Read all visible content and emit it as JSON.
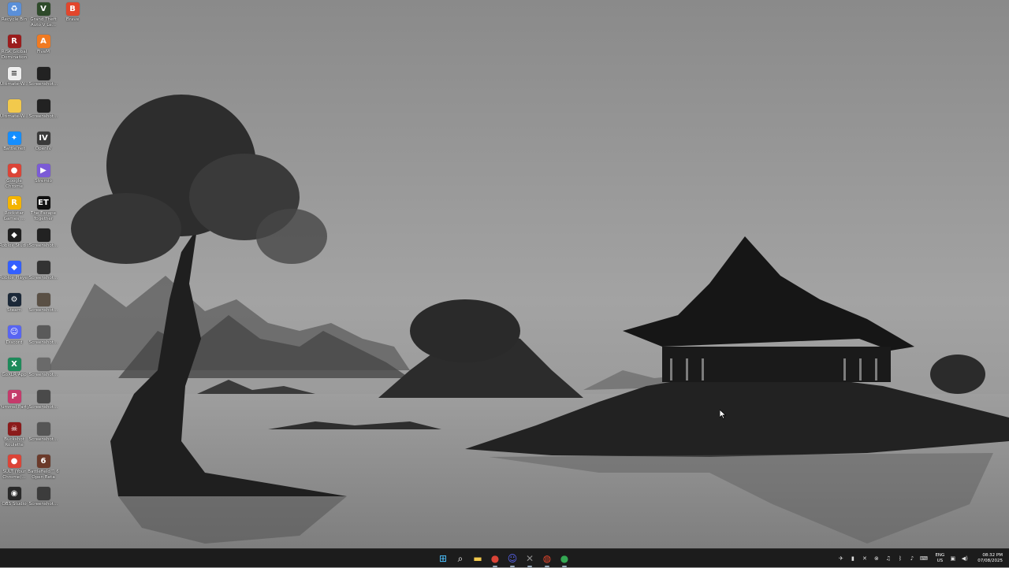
{
  "desktop": {
    "icons": [
      {
        "label": "Recycle Bin",
        "icon": "recycle-bin-icon",
        "color": "#5a8fd8",
        "glyph": "♻"
      },
      {
        "label": "Grand Theft Auto V Le...",
        "icon": "gta-icon",
        "color": "#2e4a2a",
        "glyph": "V"
      },
      {
        "label": "Brave",
        "icon": "brave-icon",
        "color": "#e2462c",
        "glyph": "B"
      },
      {
        "label": "RISK Global Domination",
        "icon": "risk-icon",
        "color": "#9b1c1c",
        "glyph": "R"
      },
      {
        "label": "FiveM",
        "icon": "fivem-icon",
        "color": "#f07a22",
        "glyph": "A"
      },
      {
        "label": "Ultimate-W...",
        "icon": "text-file-icon",
        "color": "#eeeeee",
        "glyph": "≡"
      },
      {
        "label": "Screenshot...",
        "icon": "screenshot-icon",
        "color": "#222222",
        "glyph": ""
      },
      {
        "label": "Ultimate-W...",
        "icon": "folder-icon",
        "color": "#f2c94c",
        "glyph": ""
      },
      {
        "label": "Screenshot...",
        "icon": "screenshot-icon",
        "color": "#222222",
        "glyph": ""
      },
      {
        "label": "Battle.net",
        "icon": "battlenet-icon",
        "color": "#148eff",
        "glyph": "✦"
      },
      {
        "label": "OpenIV",
        "icon": "openiv-icon",
        "color": "#3a3a3a",
        "glyph": "IV"
      },
      {
        "label": "Google Chrome",
        "icon": "chrome-icon",
        "color": "#db4437",
        "glyph": "●"
      },
      {
        "label": "Stremio",
        "icon": "stremio-icon",
        "color": "#7b5bd6",
        "glyph": "▶"
      },
      {
        "label": "Rockstar Games ...",
        "icon": "rockstar-icon",
        "color": "#f4b400",
        "glyph": "R"
      },
      {
        "label": "The Escape Together",
        "icon": "escape-together-icon",
        "color": "#111111",
        "glyph": "ET"
      },
      {
        "label": "Roblox Studio",
        "icon": "roblox-studio-icon",
        "color": "#1f1f1f",
        "glyph": "◆"
      },
      {
        "label": "Screenshot...",
        "icon": "screenshot-icon",
        "color": "#222222",
        "glyph": ""
      },
      {
        "label": "Roblox Player",
        "icon": "roblox-player-icon",
        "color": "#335fff",
        "glyph": "◆"
      },
      {
        "label": "Screenshot...",
        "icon": "screenshot-icon",
        "color": "#333333",
        "glyph": ""
      },
      {
        "label": "Steam",
        "icon": "steam-icon",
        "color": "#1b2838",
        "glyph": "⚙"
      },
      {
        "label": "Screenshot...",
        "icon": "screenshot-icon",
        "color": "#5a5045",
        "glyph": ""
      },
      {
        "label": "Discord",
        "icon": "discord-icon",
        "color": "#5865f2",
        "glyph": "☺"
      },
      {
        "label": "Screenshot...",
        "icon": "screenshot-icon",
        "color": "#5a5a5a",
        "glyph": ""
      },
      {
        "label": "GoXLR App",
        "icon": "goxlr-icon",
        "color": "#1d8a5a",
        "glyph": "X"
      },
      {
        "label": "Screenshot...",
        "icon": "screenshot-icon",
        "color": "#6a6a6a",
        "glyph": ""
      },
      {
        "label": "Pummel Party",
        "icon": "pummel-party-icon",
        "color": "#c53a6b",
        "glyph": "P"
      },
      {
        "label": "Screenshot...",
        "icon": "screenshot-icon",
        "color": "#4a4a4a",
        "glyph": ""
      },
      {
        "label": "Buckshot Roulette",
        "icon": "buckshot-roulette-icon",
        "color": "#8b1a1a",
        "glyph": "☠"
      },
      {
        "label": "Screenshot...",
        "icon": "screenshot-icon",
        "color": "#555555",
        "glyph": ""
      },
      {
        "label": "SULT (Your Chrome)...",
        "icon": "chrome-profile-icon",
        "color": "#db4437",
        "glyph": "●"
      },
      {
        "label": "Battlefield™ 6 Open Beta",
        "icon": "battlefield-icon",
        "color": "#6b3a2a",
        "glyph": "6"
      },
      {
        "label": "OBS Studio",
        "icon": "obs-icon",
        "color": "#2a2a2a",
        "glyph": "◉"
      },
      {
        "label": "Screenshot...",
        "icon": "screenshot-icon",
        "color": "#3c3c3c",
        "glyph": ""
      }
    ]
  },
  "taskbar": {
    "apps": [
      {
        "name": "start-button",
        "icon": "windows-icon",
        "color": "#4cc2ff",
        "glyph": "⊞"
      },
      {
        "name": "search-button",
        "icon": "search-icon",
        "color": "#ffffff",
        "glyph": "⌕"
      },
      {
        "name": "file-explorer-button",
        "icon": "folder-icon",
        "color": "#f2c94c",
        "glyph": "▬"
      },
      {
        "name": "chrome-button",
        "icon": "chrome-icon",
        "color": "#db4437",
        "glyph": "●"
      },
      {
        "name": "discord-button",
        "icon": "discord-icon",
        "color": "#5865f2",
        "glyph": "☺"
      },
      {
        "name": "xbox-button",
        "icon": "xbox-icon",
        "color": "#8a8a8a",
        "glyph": "✕"
      },
      {
        "name": "brave-button",
        "icon": "brave-icon",
        "color": "#e2462c",
        "glyph": "◍"
      },
      {
        "name": "chrome-profile-button",
        "icon": "chrome-icon",
        "color": "#34a853",
        "glyph": "●"
      }
    ],
    "tray": {
      "icons": [
        "steam-tray-icon",
        "app-tray-icon",
        "xbox-tray-icon",
        "goxlr-tray-icon",
        "headset-icon",
        "bluetooth-icon",
        "microphone-icon",
        "keyboard-icon"
      ],
      "lang_top": "ENG",
      "lang_bottom": "US",
      "time": "08:32 PM",
      "date": "07/08/2025"
    }
  }
}
